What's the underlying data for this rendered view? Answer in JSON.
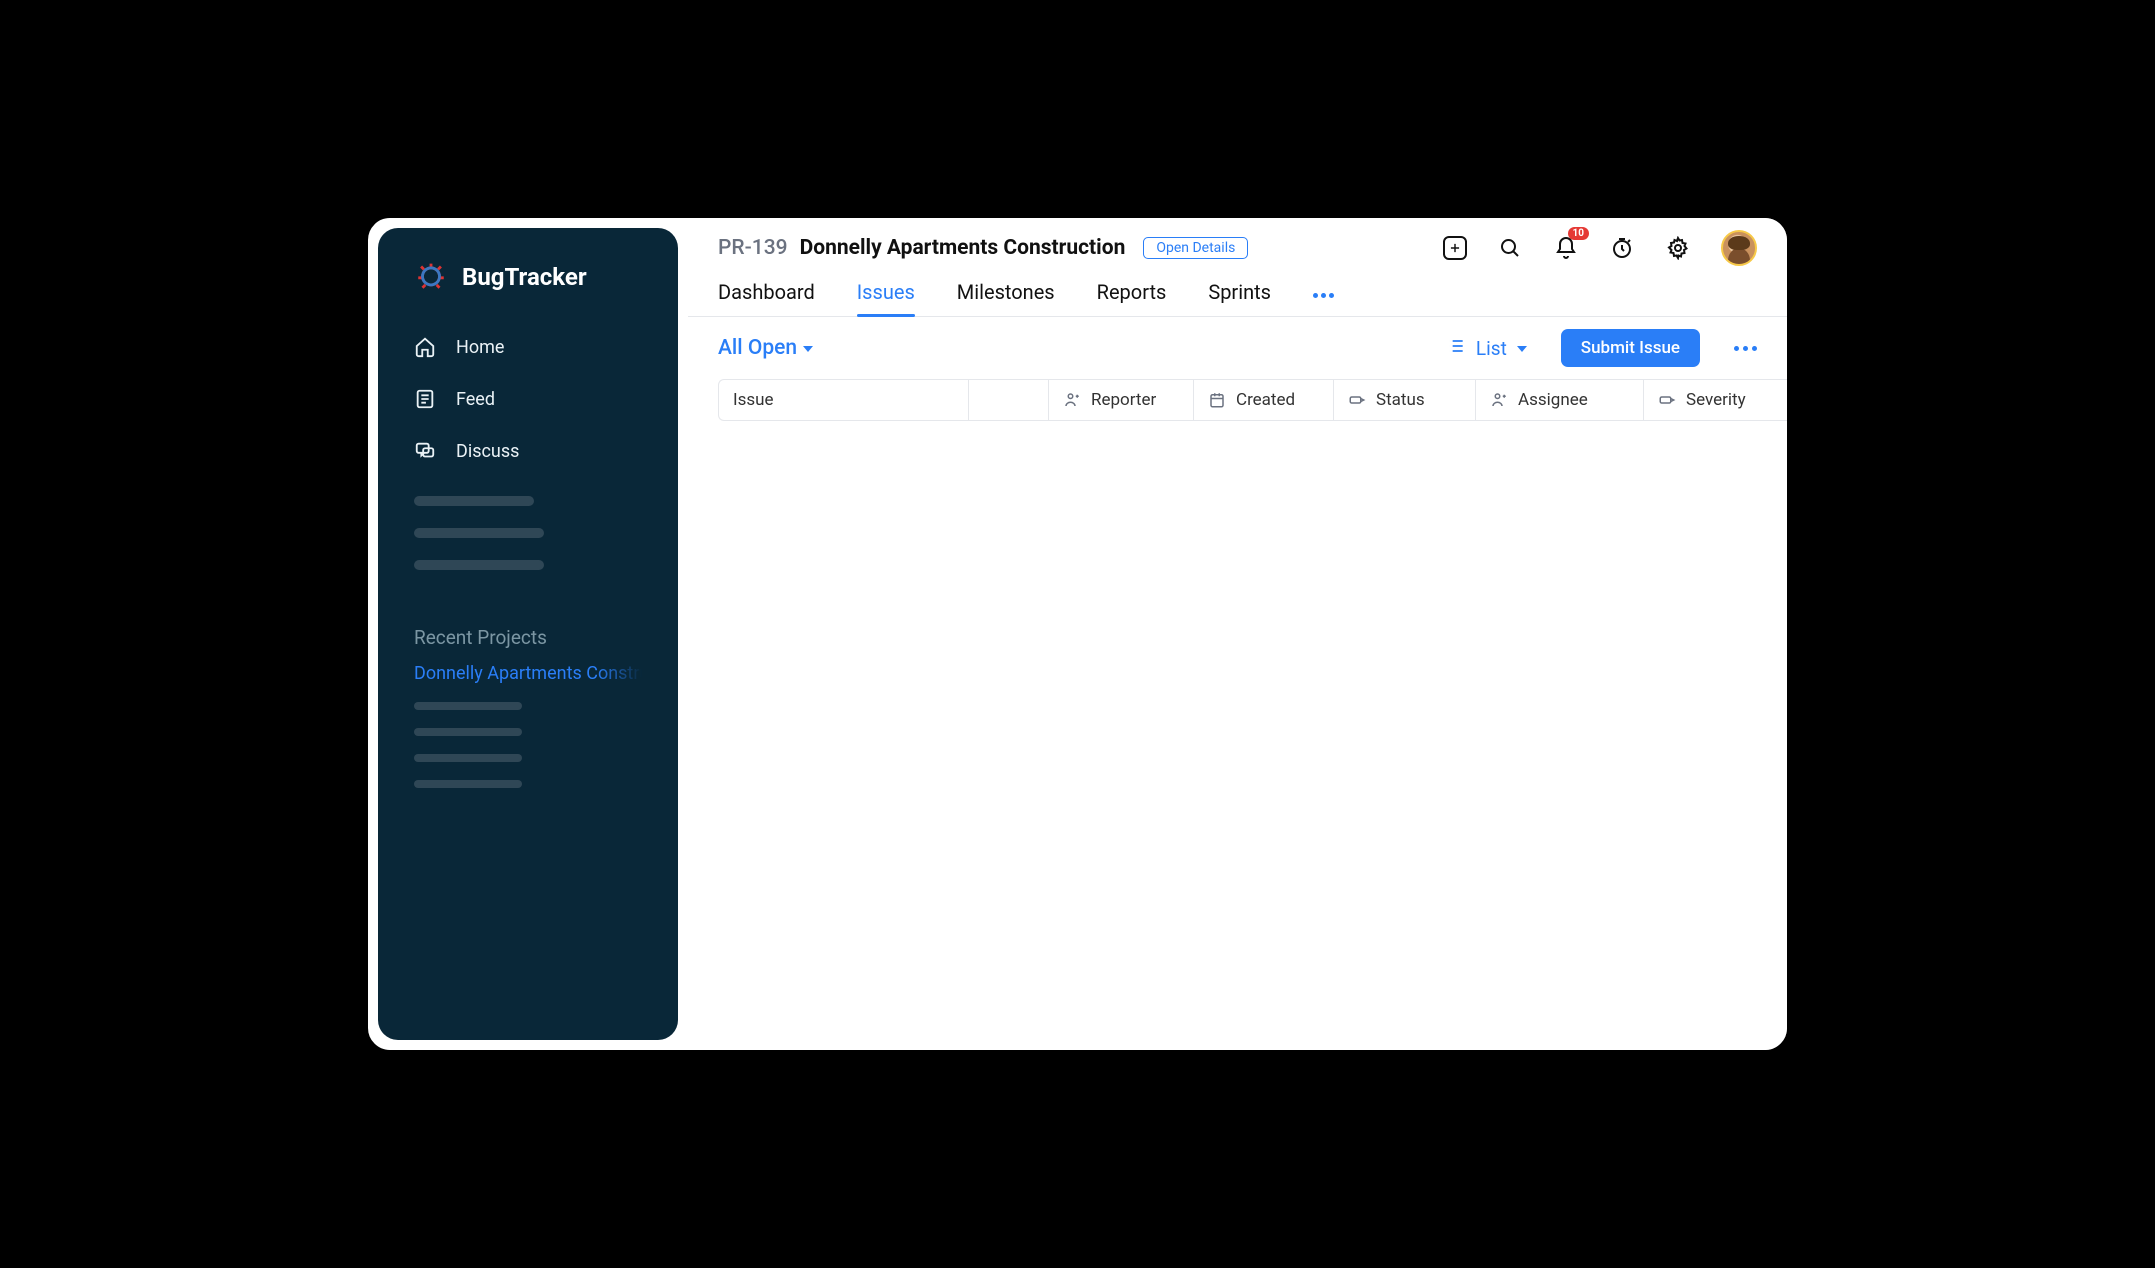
{
  "brand": "BugTracker",
  "sidebar": {
    "items": [
      {
        "label": "Home"
      },
      {
        "label": "Feed"
      },
      {
        "label": "Discuss"
      }
    ],
    "recent_title": "Recent Projects",
    "recent": [
      {
        "label": "Donnelly Apartments Construction"
      }
    ]
  },
  "header": {
    "project_id": "PR-139",
    "project_name": "Donnelly Apartments Construction",
    "open_details": "Open Details",
    "notification_count": "10"
  },
  "tabs": [
    {
      "label": "Dashboard"
    },
    {
      "label": "Issues"
    },
    {
      "label": "Milestones"
    },
    {
      "label": "Reports"
    },
    {
      "label": "Sprints"
    }
  ],
  "toolbar": {
    "filter_label": "All Open",
    "view_label": "List",
    "submit_label": "Submit Issue"
  },
  "columns": {
    "issue": "Issue",
    "reporter": "Reporter",
    "created": "Created",
    "status": "Status",
    "assignee": "Assignee",
    "severity": "Severity"
  }
}
